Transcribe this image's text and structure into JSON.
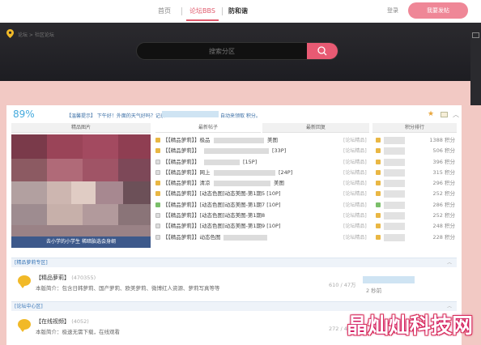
{
  "nav": {
    "links": [
      "首页",
      "论坛BBS",
      "防和谐"
    ],
    "login": "登录",
    "post_button": "我要发帖"
  },
  "banner": {
    "breadcrumb": "论坛 > 社区论坛",
    "search_placeholder": "搜索分区"
  },
  "greeting": {
    "percent": "89%",
    "text": "【温馨提示】 下午好！外面的天气好吗？记录",
    "text_after": "自动来领取 积分。"
  },
  "columns": {
    "featured": "精品图片",
    "latest_posts": "最新帖子",
    "latest_replies": "最新回复",
    "points_rank": "积分排行"
  },
  "featured_caption": "去小学的小学生 稀暗胎选会身纲",
  "threads": [
    {
      "icon": "y",
      "title": "【【精品萝莉】】极品",
      "tail": "美图",
      "tag": "[论坛精品]"
    },
    {
      "icon": "y",
      "title": "【【精品萝莉】】",
      "tail": "[33P]",
      "tag": "[论坛精品]"
    },
    {
      "icon": "w",
      "title": "【【精品萝莉】】",
      "tail": "[15P]",
      "tag": "[论坛精品]"
    },
    {
      "icon": "w",
      "title": "【【精品萝莉】】网上",
      "tail": "[24P]",
      "tag": "[论坛精品]"
    },
    {
      "icon": "y",
      "title": "【【精品萝莉】】清凉",
      "tail": "美图",
      "tag": "[论坛精品]"
    },
    {
      "icon": "y",
      "title": "【【精品萝莉】】[动态色图]动态美图-第1期5 [10P]",
      "tail": "",
      "tag": "[论坛精品]"
    },
    {
      "icon": "g",
      "title": "【【精品萝莉】】[动态色图]动态美图-第1期7 [10P]",
      "tail": "",
      "tag": "[论坛精品]"
    },
    {
      "icon": "w",
      "title": "【【精品萝莉】】[动态色图]动态美图-第1期8",
      "tail": "",
      "tag": "[论坛精品]"
    },
    {
      "icon": "w",
      "title": "【【精品萝莉】】[动态色图]动态美图-第1期9 [10P]",
      "tail": "",
      "tag": "[论坛精品]"
    },
    {
      "icon": "w",
      "title": "【【精品萝莉】】动态色图",
      "tail": "",
      "tag": "[论坛精品]"
    }
  ],
  "ranks": [
    {
      "icon": "y",
      "points": "1388 积分"
    },
    {
      "icon": "y",
      "points": "506 积分"
    },
    {
      "icon": "y",
      "points": "396 积分"
    },
    {
      "icon": "y",
      "points": "315 积分"
    },
    {
      "icon": "y",
      "points": "296 积分"
    },
    {
      "icon": "y",
      "points": "252 积分"
    },
    {
      "icon": "g",
      "points": "286 积分"
    },
    {
      "icon": "y",
      "points": "252 积分"
    },
    {
      "icon": "y",
      "points": "248 积分"
    },
    {
      "icon": "y",
      "points": "228 积分"
    }
  ],
  "sections": [
    {
      "title": "[精品萝莉专区]",
      "forum_name": "【精品萝莉】",
      "count": "(470355)",
      "desc": "本版简介：包含日韩萝莉、国产萝莉、欧美萝莉、微博红人资源、萝莉写真等等",
      "stats": "610 / 47万",
      "latest_time": "2 秒前"
    },
    {
      "title": "[论坛中心区]",
      "forum_name": "【在线视频】",
      "count": "(4052)",
      "desc": "本版简介：极速无需下载，在线观看",
      "stats": "272 / 40万",
      "latest_time": ""
    }
  ],
  "watermark": "晶灿灿科技网",
  "colors": {
    "accent": "#e05b6d",
    "banner": "#2b2a2e",
    "page_bg": "#f2c9c4",
    "link_blue": "#3a77b8"
  }
}
